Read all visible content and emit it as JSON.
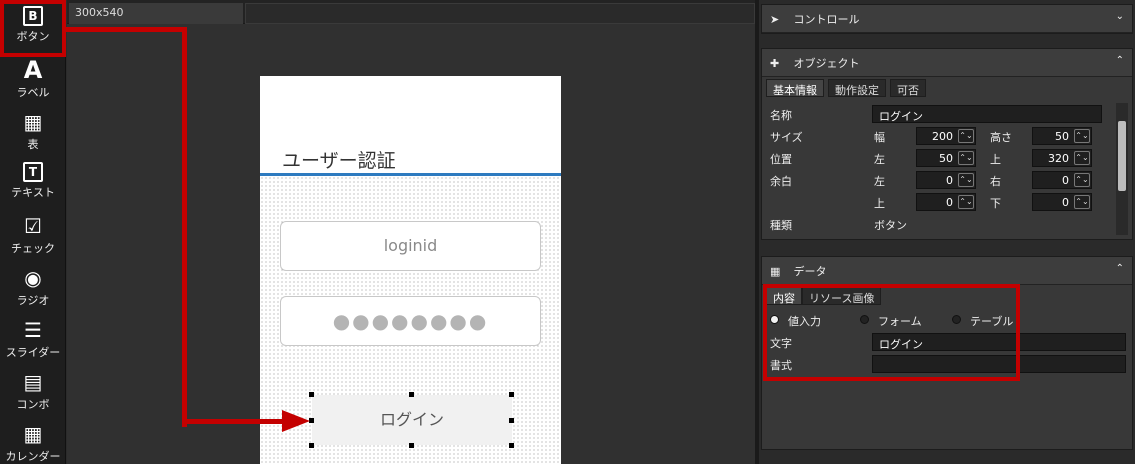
{
  "toolbox": [
    {
      "label": "ボタン",
      "glyph": "B"
    },
    {
      "label": "ラベル",
      "glyph": "A"
    },
    {
      "label": "表",
      "glyph": "▦"
    },
    {
      "label": "テキスト",
      "glyph": "T"
    },
    {
      "label": "チェック",
      "glyph": "☑"
    },
    {
      "label": "ラジオ",
      "glyph": "◉"
    },
    {
      "label": "スライダー",
      "glyph": "☰"
    },
    {
      "label": "コンボ",
      "glyph": "▤"
    },
    {
      "label": "カレンダー",
      "glyph": "▦"
    }
  ],
  "canvas": {
    "tab_label": "300x540",
    "screen_title": "ユーザー認証",
    "login_id_text": "loginid",
    "password_mask": "●●●●●●●●",
    "login_button": "ログイン"
  },
  "panels": {
    "control": {
      "title": "コントロール",
      "chevron": "⌄"
    },
    "object": {
      "title": "オブジェクト",
      "chevron": "⌃",
      "tabs": [
        "基本情報",
        "動作設定",
        "可否"
      ],
      "name_label": "名称",
      "name_value": "ログイン",
      "size_label": "サイズ",
      "width_label": "幅",
      "width_value": "200",
      "height_label": "高さ",
      "height_value": "50",
      "position_label": "位置",
      "left_label": "左",
      "left_value": "50",
      "top_label": "上",
      "top_value": "320",
      "margin_label": "余白",
      "m_left_label": "左",
      "m_left_value": "0",
      "m_right_label": "右",
      "m_right_value": "0",
      "m_top_label": "上",
      "m_top_value": "0",
      "m_bottom_label": "下",
      "m_bottom_value": "0",
      "type_label": "種類",
      "type_value": "ボタン"
    },
    "data": {
      "title": "データ",
      "chevron": "⌃",
      "tabs": [
        "内容",
        "リソース画像"
      ],
      "radio_options": [
        "値入力",
        "フォーム",
        "テーブル"
      ],
      "selected": "値入力",
      "text_label": "文字",
      "text_value": "ログイン",
      "format_label": "書式",
      "format_value": ""
    }
  },
  "colors": {
    "highlight": "#c40000",
    "accent_line": "#2e7bc0"
  }
}
